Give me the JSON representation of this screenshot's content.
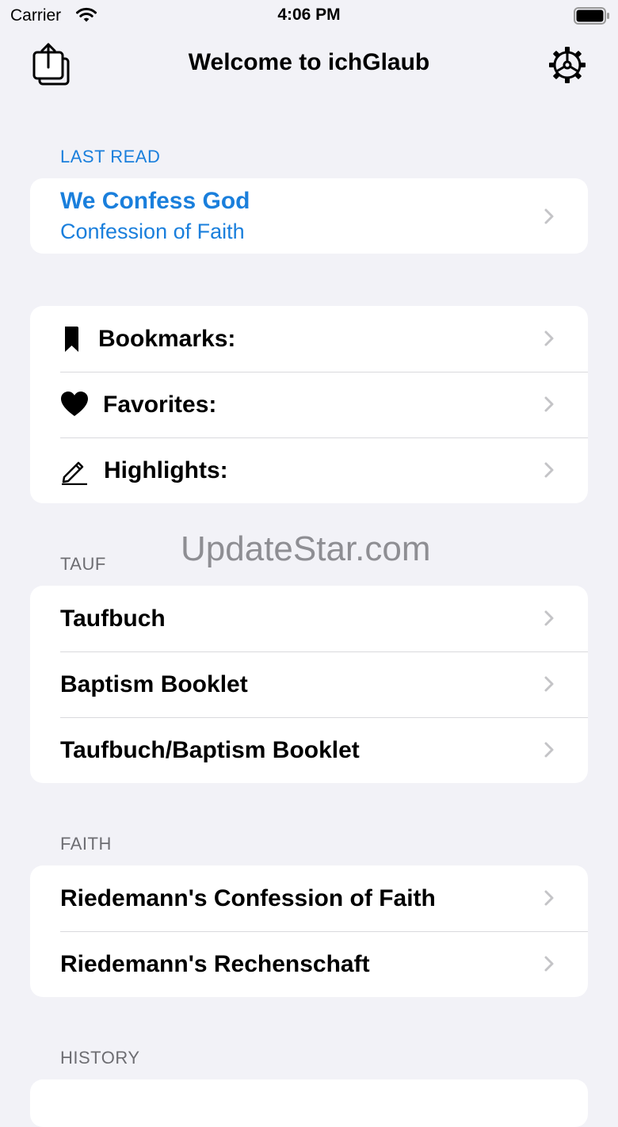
{
  "status": {
    "carrier": "Carrier",
    "time": "4:06 PM"
  },
  "nav": {
    "title": "Welcome to ichGlaub"
  },
  "last_read": {
    "header": "LAST READ",
    "title": "We Confess God",
    "subtitle": "Confession of Faith"
  },
  "library": {
    "items": [
      {
        "label": "Bookmarks:",
        "icon": "bookmark-icon"
      },
      {
        "label": "Favorites:",
        "icon": "heart-icon"
      },
      {
        "label": "Highlights:",
        "icon": "pencil-icon"
      }
    ]
  },
  "tauf": {
    "header": "TAUF",
    "items": [
      {
        "label": "Taufbuch"
      },
      {
        "label": "Baptism Booklet"
      },
      {
        "label": "Taufbuch/Baptism Booklet"
      }
    ]
  },
  "faith": {
    "header": "FAITH",
    "items": [
      {
        "label": "Riedemann's Confession of Faith"
      },
      {
        "label": "Riedemann's Rechenschaft"
      }
    ]
  },
  "history": {
    "header": "HISTORY"
  },
  "watermark": "UpdateStar.com",
  "colors": {
    "accent": "#1a7fdc",
    "background": "#f2f2f7",
    "card": "#ffffff",
    "secondary_text": "#6d6d72"
  }
}
